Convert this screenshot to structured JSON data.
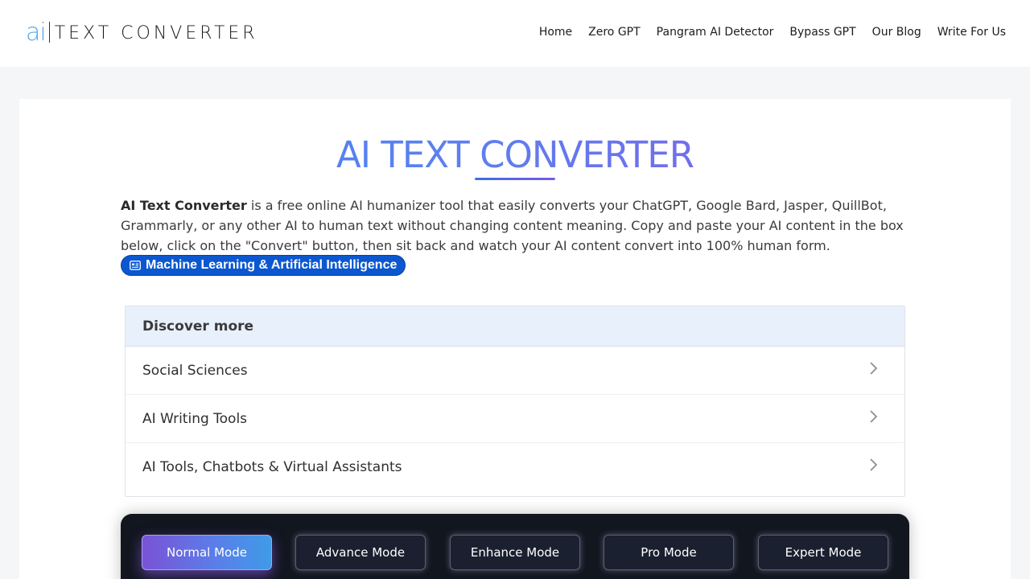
{
  "header": {
    "logo_mark": "ai",
    "logo_text": "TEXT CONVERTER",
    "nav": [
      "Home",
      "Zero GPT",
      "Pangram AI Detector",
      "Bypass GPT",
      "Our Blog",
      "Write For Us"
    ]
  },
  "main": {
    "title": "AI TEXT CONVERTER",
    "intro_bold": "AI Text Converter",
    "intro_rest": " is a free online AI humanizer tool that easily converts your ChatGPT, Google Bard, Jasper, QuillBot, Grammarly, or any other AI to human text without changing content meaning. Copy and paste your AI content in the box below, click on the \"Convert\" button, then sit back and watch your AI content convert into 100% human form.",
    "topic_chip": "Machine Learning & Artificial Intelligence"
  },
  "discover": {
    "heading": "Discover more",
    "items": [
      "Social Sciences",
      "AI Writing Tools",
      "AI Tools, Chatbots & Virtual Assistants"
    ]
  },
  "modes": {
    "buttons": [
      "Normal Mode",
      "Advance Mode",
      "Enhance Mode",
      "Pro Mode",
      "Expert Mode"
    ],
    "active": "Normal Mode"
  },
  "colors": {
    "accent_blue": "#3d8cef",
    "accent_purple": "#8a57e6",
    "chip_blue": "#0b57d0",
    "mode_panel": "#12161f"
  }
}
